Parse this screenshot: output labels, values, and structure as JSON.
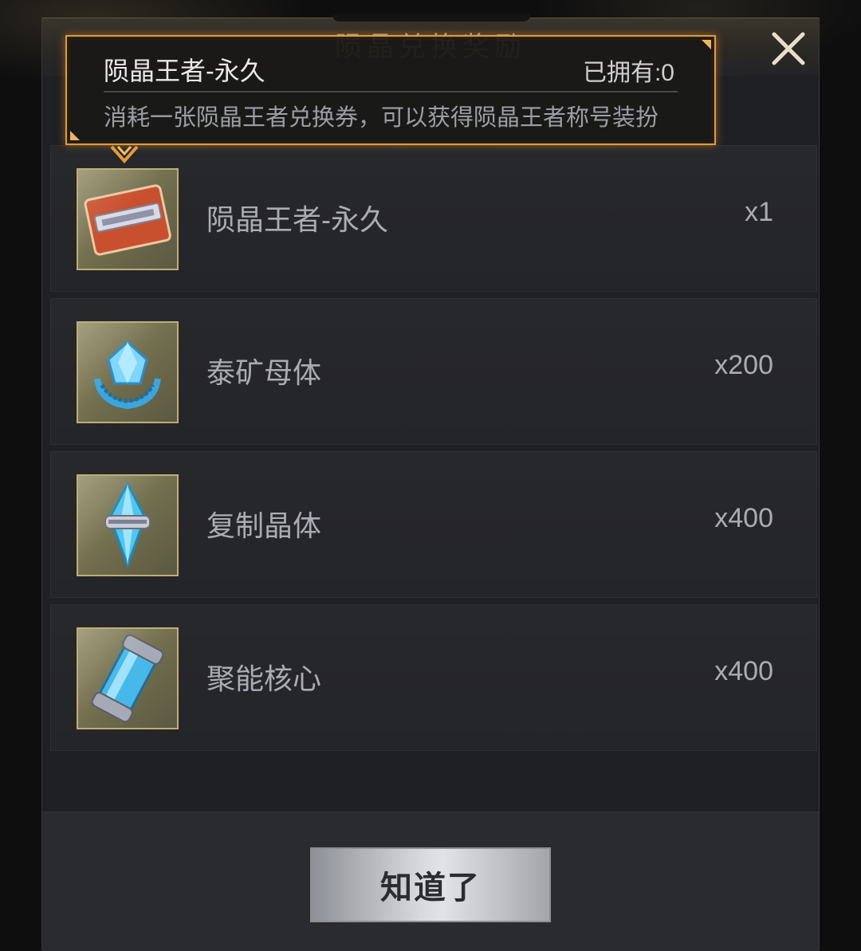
{
  "dialog": {
    "title": "陨晶兑换奖励",
    "close_icon": "close-icon"
  },
  "tooltip": {
    "item_name": "陨晶王者-永久",
    "owned_label": "已拥有:0",
    "description": "消耗一张陨晶王者兑换券，可以获得陨晶王者称号装扮"
  },
  "rewards": [
    {
      "name": "陨晶王者-永久",
      "quantity": "x1",
      "icon": "title-card-icon"
    },
    {
      "name": "泰矿母体",
      "quantity": "x200",
      "icon": "crystal-matrix-icon"
    },
    {
      "name": "复制晶体",
      "quantity": "x400",
      "icon": "replica-crystal-icon"
    },
    {
      "name": "聚能核心",
      "quantity": "x400",
      "icon": "energy-core-icon"
    }
  ],
  "footer": {
    "confirm_label": "知道了"
  },
  "colors": {
    "accent_orange": "#e49a3a",
    "thumb_border": "#bfae74",
    "panel_bg": "#1f2024"
  }
}
